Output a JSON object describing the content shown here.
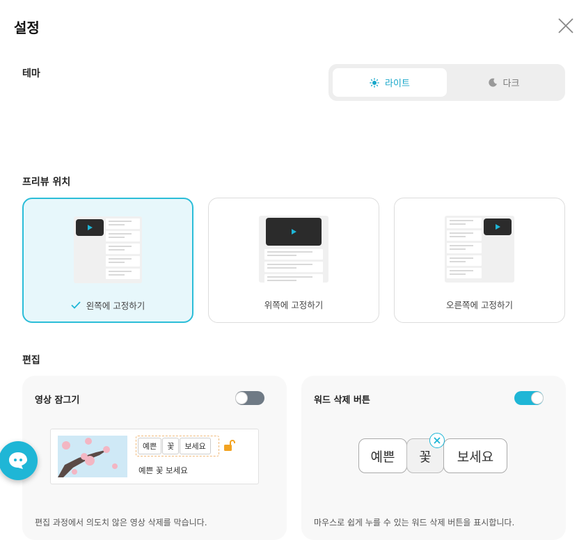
{
  "header": {
    "title": "설정"
  },
  "theme": {
    "label": "테마",
    "options": [
      {
        "label": "라이트",
        "icon": "sun-icon",
        "selected": true
      },
      {
        "label": "다크",
        "icon": "moon-icon",
        "selected": false
      }
    ]
  },
  "preview": {
    "label": "프리뷰 위치",
    "options": [
      {
        "label": "왼쪽에 고정하기",
        "selected": true
      },
      {
        "label": "위쪽에 고정하기",
        "selected": false
      },
      {
        "label": "오른쪽에 고정하기",
        "selected": false
      }
    ]
  },
  "edit": {
    "label": "편집",
    "video_lock": {
      "title": "영상 잠그기",
      "enabled": false,
      "chips": [
        "예쁜",
        "꽃",
        "보세요"
      ],
      "subtitle": "예쁜 꽃 보세요",
      "description": "편집 과정에서 의도치 않은 영상 삭제를 막습니다."
    },
    "word_delete": {
      "title": "워드 삭제 버튼",
      "enabled": true,
      "words": [
        "예쁜",
        "꽃",
        "보세요"
      ],
      "description": "마우스로 쉽게 누를 수 있는 워드 삭제 버튼을 표시합니다."
    }
  },
  "colors": {
    "accent": "#1fb6d6",
    "selected_bg": "#e7f7fb",
    "toggle_off": "#6f7a85"
  }
}
